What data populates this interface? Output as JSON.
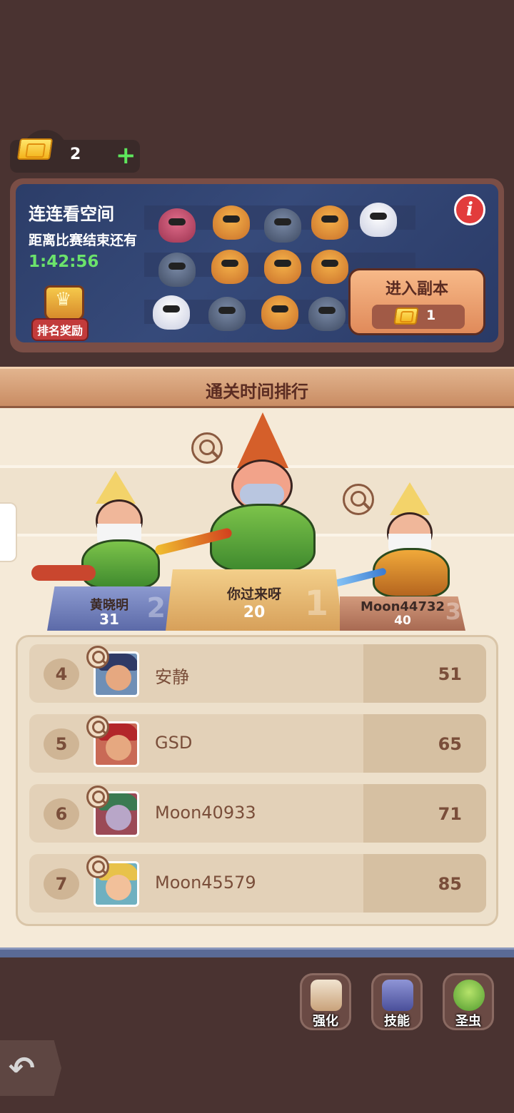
{
  "currency": {
    "ticket_count": "2",
    "add_label": "+"
  },
  "event": {
    "title": "连连看空间",
    "countdown_label": "距离比赛结束还有",
    "countdown": "1:42:56",
    "rank_reward_label": "排名奖励",
    "info_label": "i",
    "enter_label": "进入副本",
    "enter_cost": "1"
  },
  "ranking": {
    "title": "通关时间排行",
    "podium": [
      {
        "rank": "1",
        "name": "你过来呀",
        "score": "20"
      },
      {
        "rank": "2",
        "name": "黄晓明",
        "score": "31"
      },
      {
        "rank": "3",
        "name": "Moon44732",
        "score": "40"
      }
    ],
    "rows": [
      {
        "rank": "4",
        "name": "安静",
        "score": "51"
      },
      {
        "rank": "5",
        "name": "GSD",
        "score": "65"
      },
      {
        "rank": "6",
        "name": "Moon40933",
        "score": "71"
      },
      {
        "rank": "7",
        "name": "Moon45579",
        "score": "85"
      }
    ]
  },
  "actions": {
    "upgrade": "强化",
    "skill": "技能",
    "holy_bug": "圣虫"
  },
  "colors": {
    "background": "#4a3331",
    "timer": "#6be36b",
    "accent": "#e08a5a"
  }
}
